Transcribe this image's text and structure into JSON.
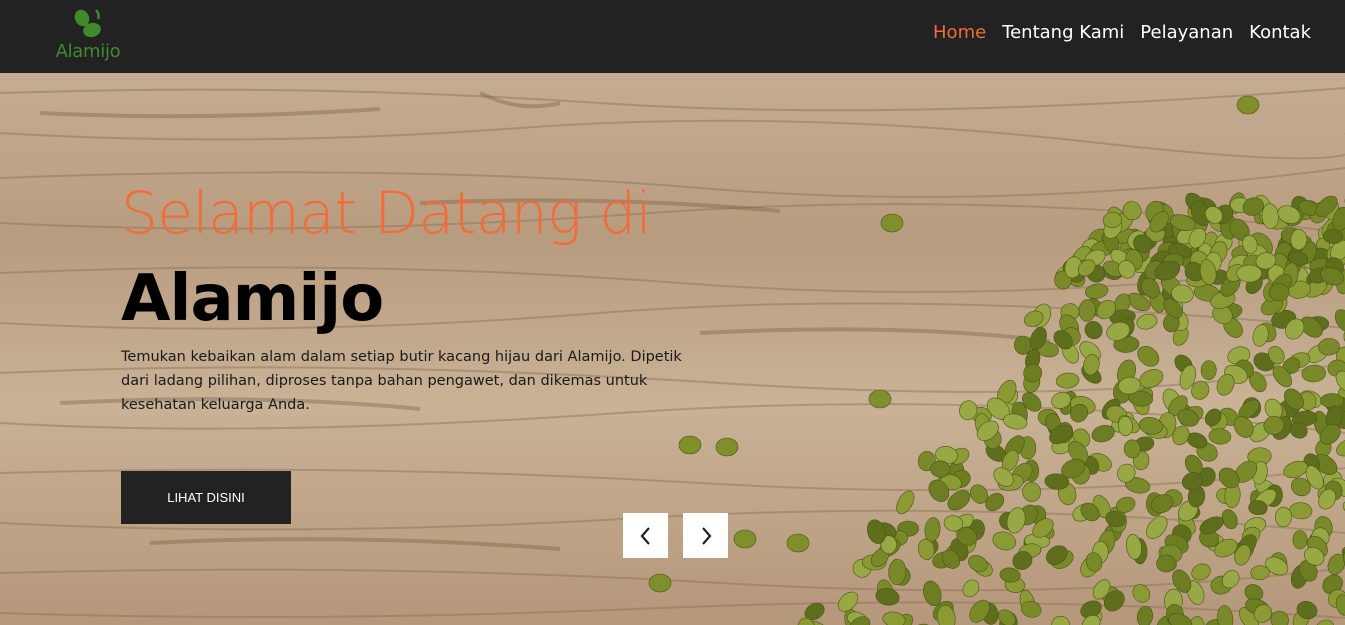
{
  "brand": {
    "logo_text": "Alamijo",
    "logo_icon": "mung-bean-logo-icon"
  },
  "nav": {
    "items": [
      {
        "label": "Home",
        "active": true
      },
      {
        "label": "Tentang Kami",
        "active": false
      },
      {
        "label": "Pelayanan",
        "active": false
      },
      {
        "label": "Kontak",
        "active": false
      }
    ]
  },
  "hero": {
    "welcome": "Selamat Datang di",
    "title": "Alamijo",
    "description": "Temukan kebaikan alam dalam setiap butir kacang hijau dari Alamijo. Dipetik dari ladang pilihan, diproses tanpa bahan pengawet, dan dikemas untuk kesehatan keluarga Anda.",
    "cta_label": "LIHAT DISINI",
    "prev_icon": "chevron-left-icon",
    "next_icon": "chevron-right-icon"
  },
  "colors": {
    "accent": "#f26b38",
    "navbar": "#222222",
    "logo_green": "#3f8b2c"
  }
}
